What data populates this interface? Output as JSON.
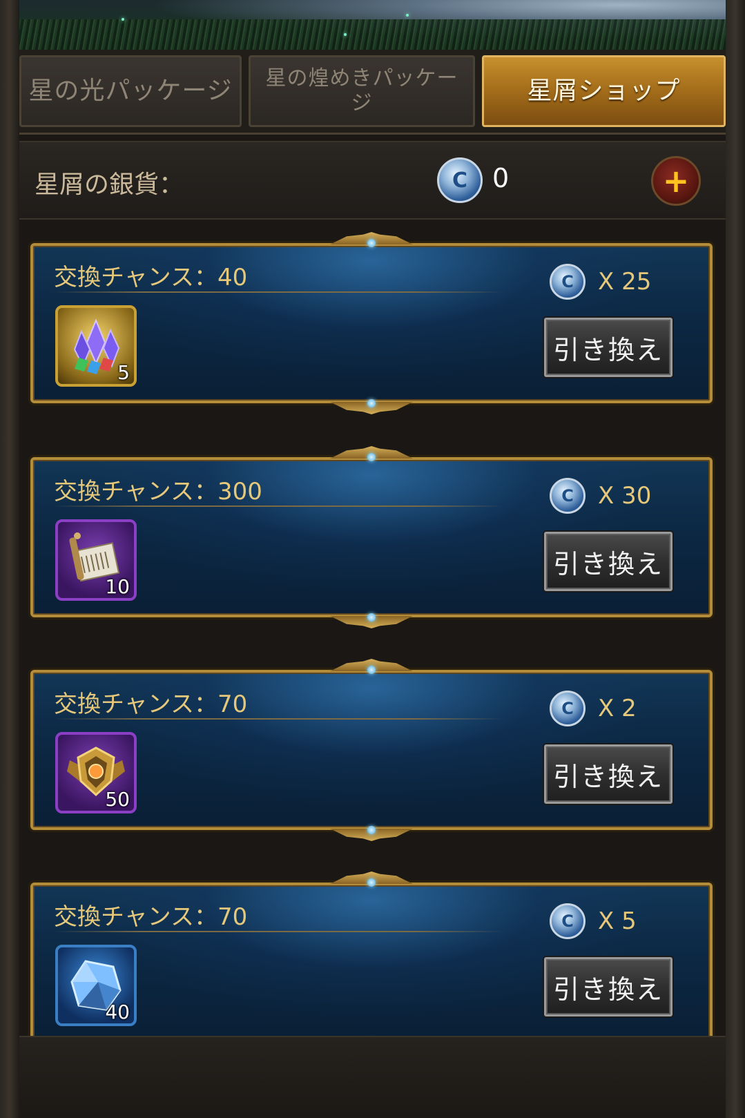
{
  "tabs": [
    {
      "label": "星の光パッケージ",
      "active": false
    },
    {
      "label": "星の煌めきパッケージ",
      "active": false
    },
    {
      "label": "星屑ショップ",
      "active": true
    }
  ],
  "currency": {
    "label": "星屑の銀貨：",
    "value": "0",
    "coin_glyph": "C",
    "add_icon": "+"
  },
  "items": [
    {
      "chance": "交換チャンス：40",
      "price": "X 25",
      "qty": "5",
      "icon": "crystal-cluster-icon",
      "button": "引き換え"
    },
    {
      "chance": "交換チャンス：300",
      "price": "X 30",
      "qty": "10",
      "icon": "scroll-icon",
      "button": "引き換え"
    },
    {
      "chance": "交換チャンス：70",
      "price": "X 2",
      "qty": "50",
      "icon": "emblem-icon",
      "button": "引き換え"
    },
    {
      "chance": "交換チャンス：70",
      "price": "X 5",
      "qty": "40",
      "icon": "ice-crystal-icon",
      "button": "引き換え"
    }
  ],
  "colors": {
    "accent_gold": "#e6c87a",
    "card_blue": "#0c2844",
    "active_tab": "#a66f1b"
  }
}
